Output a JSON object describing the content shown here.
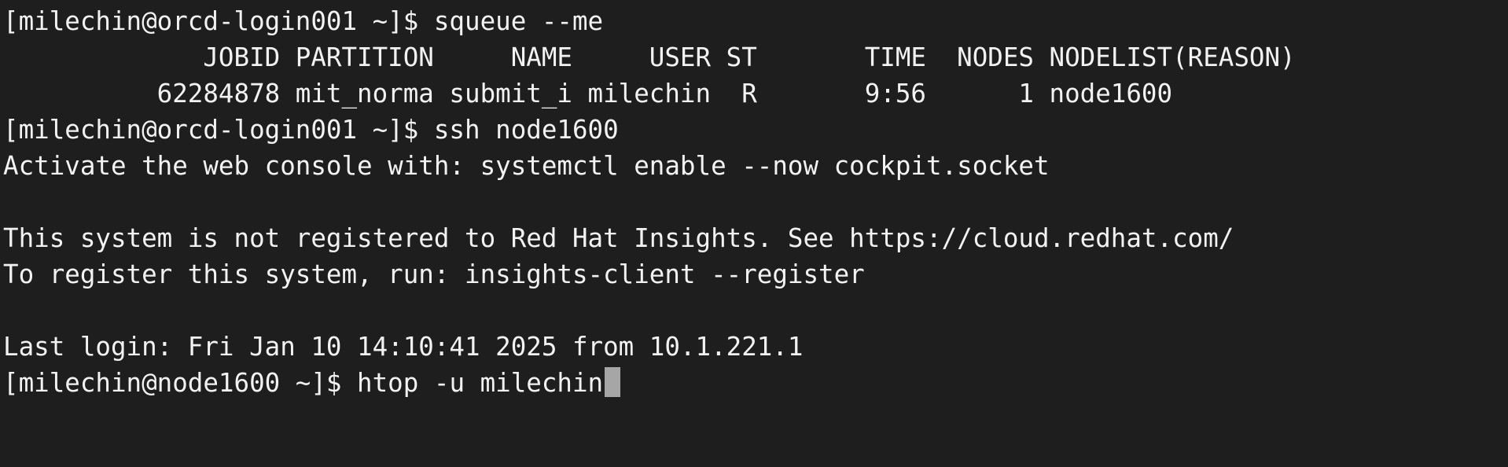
{
  "terminal": {
    "lines": [
      "[milechin@orcd-login001 ~]$ squeue --me",
      "             JOBID PARTITION     NAME     USER ST       TIME  NODES NODELIST(REASON)",
      "          62284878 mit_norma submit_i milechin  R       9:56      1 node1600",
      "[milechin@orcd-login001 ~]$ ssh node1600",
      "Activate the web console with: systemctl enable --now cockpit.socket",
      "",
      "This system is not registered to Red Hat Insights. See https://cloud.redhat.com/",
      "To register this system, run: insights-client --register",
      "",
      "Last login: Fri Jan 10 14:10:41 2025 from 10.1.221.1"
    ],
    "prompt": "[milechin@node1600 ~]$ ",
    "current_input": "htop -u milechin"
  },
  "colors": {
    "background": "#1e1e1e",
    "foreground": "#f2f2f2",
    "cursor": "#a6a6a6"
  }
}
